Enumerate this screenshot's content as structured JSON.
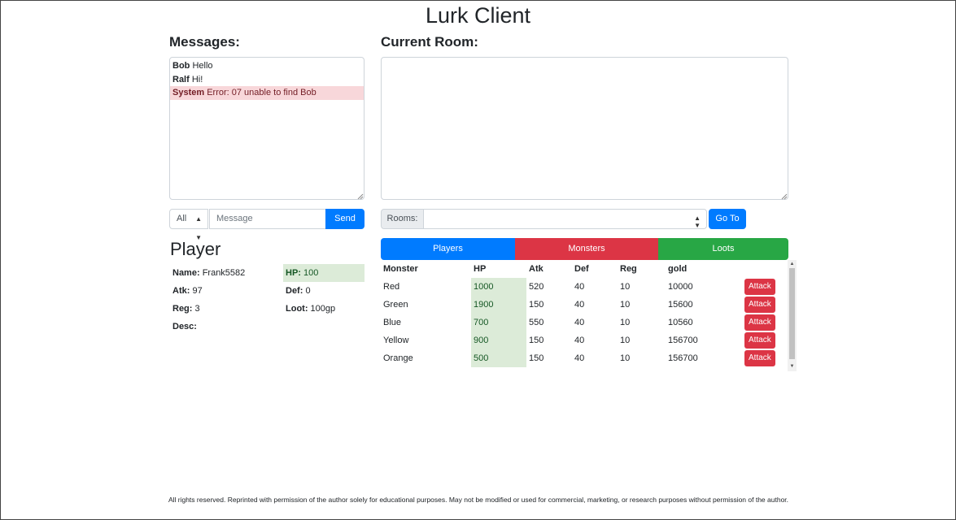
{
  "app": {
    "title": "Lurk Client"
  },
  "messages": {
    "heading": "Messages:",
    "items": [
      {
        "sender": "Bob",
        "text": "Hello"
      },
      {
        "sender": "Ralf",
        "text": "Hi!"
      },
      {
        "sender": "System",
        "text": "Error: 07 unable to find Bob"
      }
    ],
    "recipient_selected": "All",
    "input_placeholder": "Message",
    "send_label": "Send"
  },
  "room": {
    "heading": "Current Room:",
    "rooms_label": "Rooms:",
    "goto_label": "Go To"
  },
  "player": {
    "heading": "Player",
    "name_label": "Name:",
    "name": "Frank5582",
    "hp_label": "HP:",
    "hp": "100",
    "atk_label": "Atk:",
    "atk": "97",
    "def_label": "Def:",
    "def": "0",
    "reg_label": "Reg:",
    "reg": "3",
    "loot_label": "Loot:",
    "loot": "100gp",
    "desc_label": "Desc:",
    "desc": ""
  },
  "tabs": {
    "players": "Players",
    "monsters": "Monsters",
    "loots": "Loots"
  },
  "monster_table": {
    "columns": [
      "Monster",
      "HP",
      "Atk",
      "Def",
      "Reg",
      "gold"
    ],
    "action_label": "Attack",
    "rows": [
      {
        "name": "Red",
        "hp": "1000",
        "atk": "520",
        "def": "40",
        "reg": "10",
        "gold": "10000"
      },
      {
        "name": "Green",
        "hp": "1900",
        "atk": "150",
        "def": "40",
        "reg": "10",
        "gold": "15600"
      },
      {
        "name": "Blue",
        "hp": "700",
        "atk": "550",
        "def": "40",
        "reg": "10",
        "gold": "10560"
      },
      {
        "name": "Yellow",
        "hp": "900",
        "atk": "150",
        "def": "40",
        "reg": "10",
        "gold": "156700"
      },
      {
        "name": "Orange",
        "hp": "500",
        "atk": "150",
        "def": "40",
        "reg": "10",
        "gold": "156700"
      }
    ]
  },
  "colors": {
    "primary": "#007bff",
    "danger": "#dc3545",
    "success": "#28a745",
    "hp_highlight": "#dcebd8",
    "error_bg": "#f8d7da"
  },
  "footer": {
    "text": "All rights reserved. Reprinted with permission of the author solely for educational purposes. May not be modified or used for commercial, marketing, or research purposes without permission of the author."
  }
}
